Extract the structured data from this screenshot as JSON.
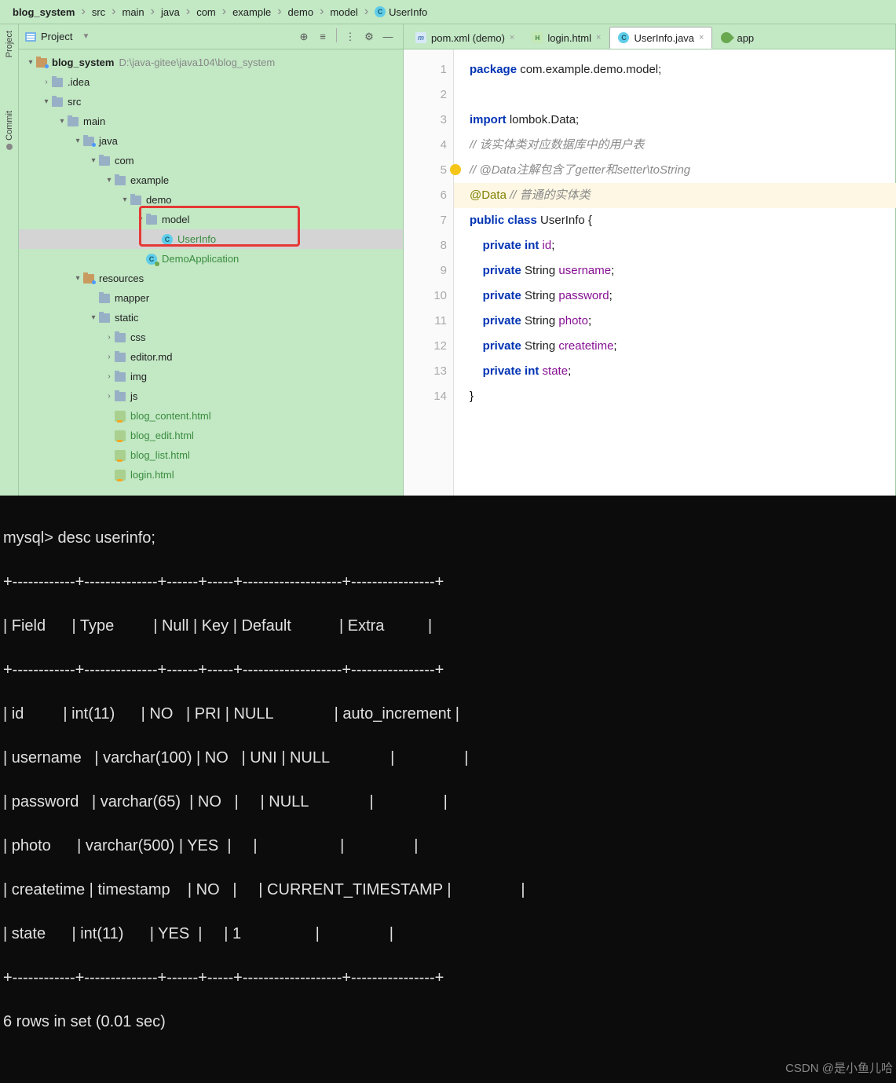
{
  "breadcrumb": [
    "blog_system",
    "src",
    "main",
    "java",
    "com",
    "example",
    "demo",
    "model"
  ],
  "breadcrumb_file": "UserInfo",
  "project_header": {
    "label": "Project"
  },
  "side_tabs": {
    "project": "Project",
    "commit": "Commit"
  },
  "tree": {
    "root": {
      "name": "blog_system",
      "path": "D:\\java-gitee\\java104\\blog_system"
    },
    "idea": ".idea",
    "src": "src",
    "main": "main",
    "java": "java",
    "com": "com",
    "example": "example",
    "demo": "demo",
    "model": "model",
    "userinfo": "UserInfo",
    "demoapp": "DemoApplication",
    "resources": "resources",
    "mapper": "mapper",
    "static": "static",
    "css": "css",
    "editor": "editor.md",
    "img": "img",
    "js": "js",
    "blog_content": "blog_content.html",
    "blog_edit": "blog_edit.html",
    "blog_list": "blog_list.html",
    "login": "login.html"
  },
  "tabs": {
    "pom": "pom.xml (demo)",
    "login": "login.html",
    "userinfo": "UserInfo.java",
    "app": "app"
  },
  "code": {
    "l1_kw": "package",
    "l1_rest": " com.example.demo.model;",
    "l3_kw": "import",
    "l3_rest": " lombok.Data;",
    "l4": "// 该实体类对应数据库中的用户表",
    "l5": "// @Data注解包含了getter和setter\\toString",
    "l6_ann": "@Data",
    "l6_cmt": " // 普通的实体类",
    "l7_a": "public class ",
    "l7_b": "UserInfo {",
    "l8_a": "    private int ",
    "l8_b": "id",
    "l8_c": ";",
    "l9_a": "    private ",
    "l9_t": "String ",
    "l9_f": "username",
    "l9_c": ";",
    "l10_a": "    private ",
    "l10_t": "String ",
    "l10_f": "password",
    "l10_c": ";",
    "l11_a": "    private ",
    "l11_t": "String ",
    "l11_f": "photo",
    "l11_c": ";",
    "l12_a": "    private ",
    "l12_t": "String ",
    "l12_f": "createtime",
    "l12_c": ";",
    "l13_a": "    private int ",
    "l13_f": "state",
    "l13_c": ";",
    "l14": "}"
  },
  "terminal": {
    "prompt": "mysql> desc userinfo;",
    "header": "| Field      | Type         | Null | Key | Default           | Extra          |",
    "sep": "+------------+--------------+------+-----+-------------------+----------------+",
    "r1": "| id         | int(11)      | NO   | PRI | NULL              | auto_increment |",
    "r2": "| username   | varchar(100) | NO   | UNI | NULL              |                |",
    "r3": "| password   | varchar(65)  | NO   |     | NULL              |                |",
    "r4": "| photo      | varchar(500) | YES  |     |                   |                |",
    "r5": "| createtime | timestamp    | NO   |     | CURRENT_TIMESTAMP |                |",
    "r6": "| state      | int(11)      | YES  |     | 1                 |                |",
    "footer": "6 rows in set (0.01 sec)",
    "watermark": "CSDN @是小鱼儿哈"
  }
}
